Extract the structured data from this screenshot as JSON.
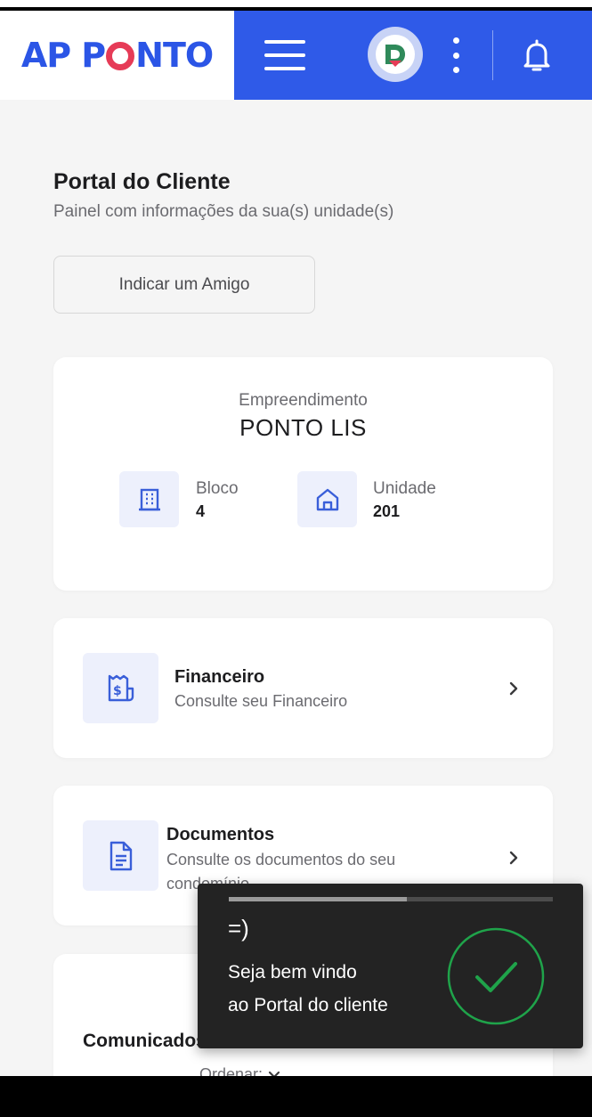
{
  "header": {
    "logo_left": "AP P",
    "logo_right": "NTO",
    "brand_color": "#2f5ae8",
    "accent_color": "#e63b57",
    "avatar_letter": "D"
  },
  "intro": {
    "title": "Portal do Cliente",
    "subtitle": "Painel com informações da sua(s) unidade(s)",
    "indicate_button": "Indicar um Amigo"
  },
  "empreendimento": {
    "label": "Empreendimento",
    "name": "PONTO LIS",
    "bloco_label": "Bloco",
    "bloco_value": "4",
    "unidade_label": "Unidade",
    "unidade_value": "201"
  },
  "financeiro": {
    "title": "Financeiro",
    "subtitle": "Consulte seu Financeiro"
  },
  "documentos": {
    "title": "Documentos",
    "subtitle": "Consulte os documentos do seu condomínio"
  },
  "comunicados": {
    "title": "Comunicados",
    "order_label": "Ordenar:"
  },
  "toast": {
    "emoji": "=)",
    "line1": "Seja bem vindo",
    "line2": "ao Portal do cliente",
    "progress": 0.55,
    "success_color": "#1fa34a"
  }
}
